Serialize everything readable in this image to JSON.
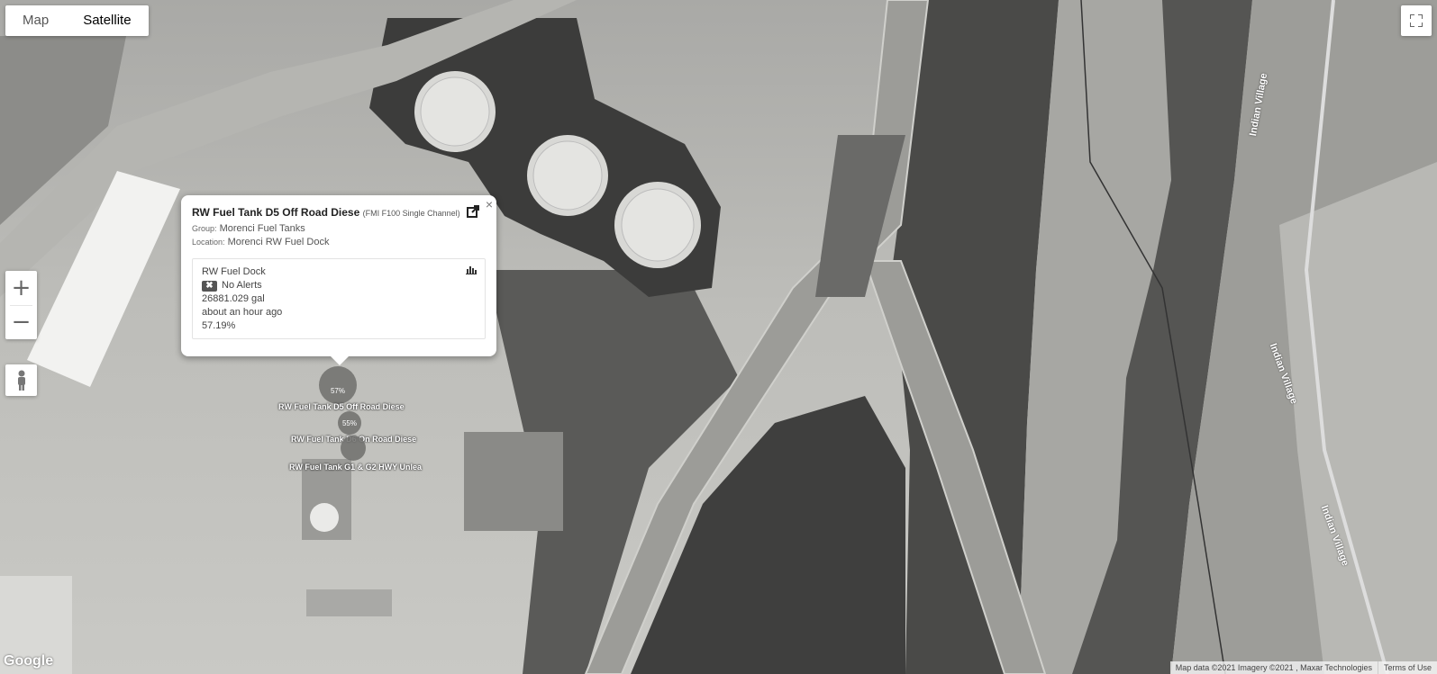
{
  "map_type": {
    "options": [
      "Map",
      "Satellite"
    ],
    "active": "Satellite"
  },
  "controls": {
    "zoom_in": "+",
    "zoom_out": "−",
    "fullscreen_icon": "fullscreen-icon",
    "pegman_icon": "pegman-icon"
  },
  "popup": {
    "title": "RW Fuel Tank D5 Off Road Diese",
    "subtitle": "(FMI F100 Single Channel)",
    "group_label": "Group:",
    "group_value": "Morenci Fuel Tanks",
    "location_label": "Location:",
    "location_value": "Morenci RW Fuel Dock",
    "close_label": "×",
    "card": {
      "name": "RW Fuel Dock",
      "alert_badge": "✖",
      "alert_text": "No Alerts",
      "volume": "26881.029 gal",
      "updated": "about an hour ago",
      "percent": "57.19%"
    }
  },
  "markers": [
    {
      "label": "RW Fuel Tank D5 Off Road Diese",
      "percent": "57%"
    },
    {
      "label": "RW Fuel Tank D6 On Road Diese",
      "percent": "55%"
    },
    {
      "label": "RW Fuel Tank G1 & G2 HWY Unlea",
      "percent": ""
    }
  ],
  "road_labels": [
    "Indian Village",
    "Indian Village",
    "Indian Village"
  ],
  "footer": {
    "google": "Google",
    "attribution": "Map data ©2021 Imagery ©2021 , Maxar Technologies",
    "terms": "Terms of Use"
  }
}
